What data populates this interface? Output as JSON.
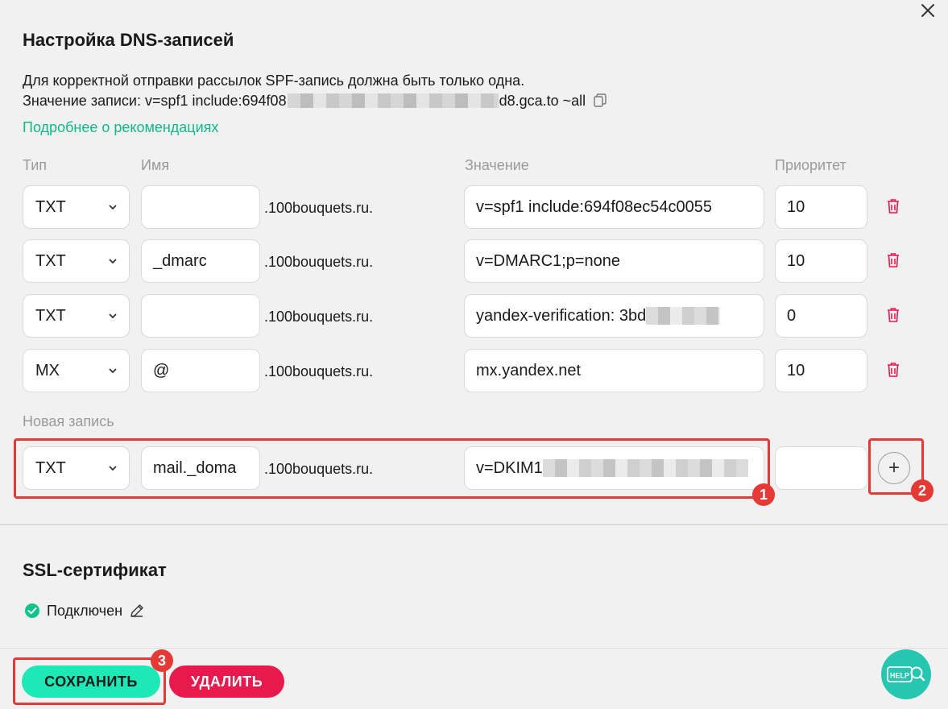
{
  "dialog": {
    "title": "Настройка DNS-записей",
    "description_line1": "Для корректной отправки рассылок SPF-запись должна быть только одна.",
    "record_value_prefix": "Значение записи: v=spf1 include:694f08",
    "record_value_suffix": "d8.gca.to ~all",
    "details_link": "Подробнее о рекомендациях"
  },
  "columns": {
    "type": "Тип",
    "name": "Имя",
    "value": "Значение",
    "priority": "Приоритет"
  },
  "records": [
    {
      "type": "TXT",
      "name": "",
      "domain": ".100bouquets.ru.",
      "value": "v=spf1 include:694f08ec54c0055",
      "priority": "10"
    },
    {
      "type": "TXT",
      "name": "_dmarc",
      "domain": ".100bouquets.ru.",
      "value": "v=DMARC1;p=none",
      "priority": "10"
    },
    {
      "type": "TXT",
      "name": "",
      "domain": ".100bouquets.ru.",
      "value": "yandex-verification: 3bd",
      "priority": "0"
    },
    {
      "type": "MX",
      "name": "@",
      "domain": ".100bouquets.ru.",
      "value": "mx.yandex.net",
      "priority": "10"
    }
  ],
  "new_record": {
    "label": "Новая запись",
    "type": "TXT",
    "name": "mail._doma",
    "domain": ".100bouquets.ru.",
    "value": "v=DKIM1",
    "priority": "",
    "add_symbol": "+"
  },
  "annotations": {
    "badge1": "1",
    "badge2": "2",
    "badge3": "3"
  },
  "ssl": {
    "title": "SSL-сертификат",
    "status": "Подключен"
  },
  "footer": {
    "save_label": "СОХРАНИТЬ",
    "delete_label": "УДАЛИТЬ",
    "help_label": "HELP"
  },
  "colors": {
    "accent_green": "#1de9b6",
    "link_green": "#12b886",
    "danger_red": "#e8194c",
    "annotation_red": "#e53935",
    "help_teal": "#26c6b0"
  }
}
